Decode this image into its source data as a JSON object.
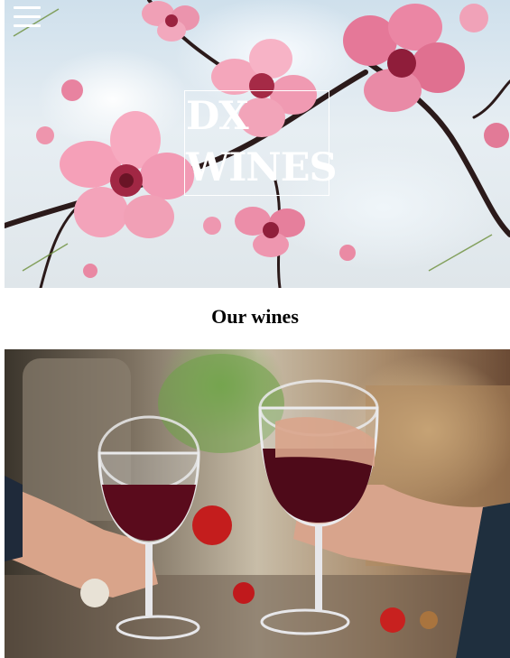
{
  "header": {
    "menu_icon": "hamburger-menu-icon",
    "logo_line1": "DX",
    "logo_line2": "WINES"
  },
  "hero_image": {
    "subject": "pink-blossom-branches"
  },
  "section": {
    "title": "Our wines"
  },
  "feature_image": {
    "subject": "two-red-wine-glasses-toast"
  },
  "colors": {
    "logo_text": "#ffffff",
    "title_text": "#000000",
    "page_background": "#ffffff"
  }
}
